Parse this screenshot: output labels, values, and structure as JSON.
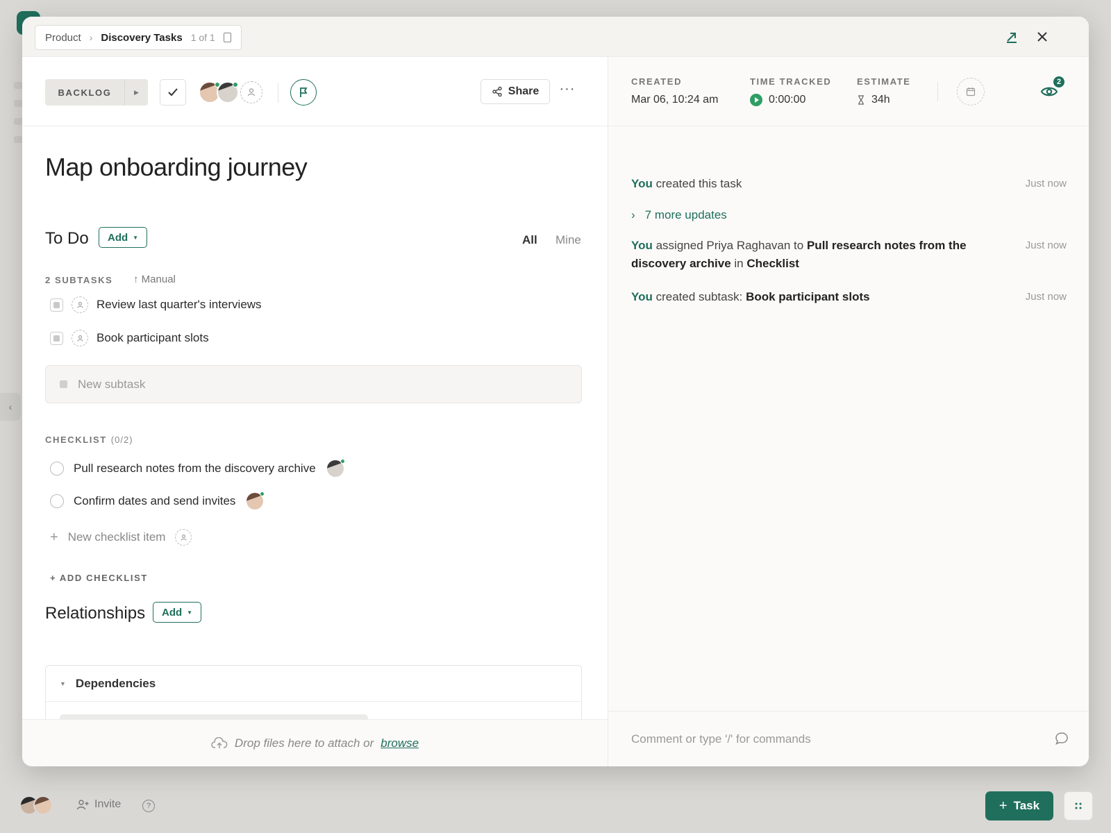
{
  "breadcrumb": {
    "parent": "Product",
    "current": "Discovery Tasks",
    "position": "1 of 1"
  },
  "toolbar": {
    "status": "BACKLOG",
    "share_label": "Share",
    "more_label": "···"
  },
  "task": {
    "title": "Map onboarding journey"
  },
  "todo": {
    "title": "To Do",
    "add_label": "Add",
    "filter_all": "All",
    "filter_mine": "Mine",
    "subtasks_label": "2 SUBTASKS",
    "sort_label": "Manual",
    "subtasks": [
      {
        "name": "Review last quarter's interviews"
      },
      {
        "name": "Book participant slots"
      }
    ],
    "new_subtask_placeholder": "New subtask"
  },
  "checklist": {
    "label": "CHECKLIST",
    "count": "(0/2)",
    "items": [
      {
        "text": "Pull research notes from the discovery archive"
      },
      {
        "text": "Confirm dates and send invites"
      }
    ],
    "new_item_placeholder": "New checklist item",
    "add_checklist_label": "+ ADD CHECKLIST"
  },
  "relationships": {
    "title": "Relationships",
    "add_label": "Add",
    "dependencies_label": "Dependencies"
  },
  "dropzone": {
    "text": "Drop files here to attach or",
    "browse_label": "browse"
  },
  "meta": {
    "created_label": "CREATED",
    "created_value": "Mar 06, 10:24 am",
    "time_tracked_label": "TIME TRACKED",
    "time_tracked_value": "0:00:00",
    "estimate_label": "ESTIMATE",
    "estimate_value": "34h",
    "watchers_count": "2"
  },
  "activity": {
    "more_updates": "7 more updates",
    "items": [
      {
        "actor": "You",
        "text": "created this task",
        "time": "Just now"
      },
      {
        "actor": "You",
        "text_before": "assigned Priya Raghavan to",
        "target": "Pull research notes from the discovery archive",
        "text_mid": "in",
        "target2": "Checklist",
        "time": "Just now"
      },
      {
        "actor": "You",
        "text_before": "created subtask:",
        "target": "Book participant slots",
        "time": "Just now"
      }
    ]
  },
  "comment": {
    "placeholder": "Comment or type '/' for commands"
  },
  "footer": {
    "invite_label": "Invite",
    "task_button_label": "Task",
    "help_label": "?"
  },
  "colors": {
    "accent": "#1f6f5c",
    "online": "#2f9e66"
  }
}
